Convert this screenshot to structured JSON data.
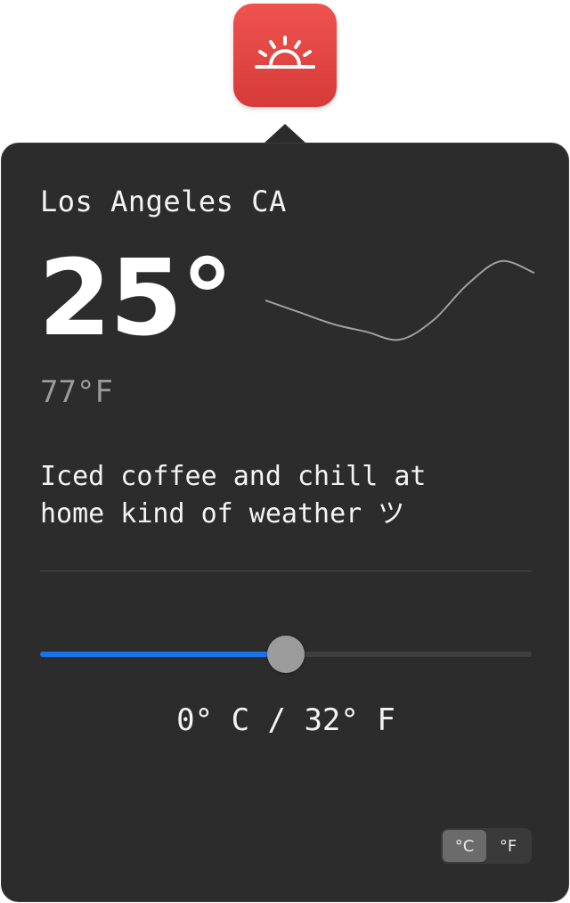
{
  "app_icon": {
    "icon": "sunrise-icon",
    "color": "#e5453f"
  },
  "weather": {
    "location": "Los Angeles CA",
    "temperature_main": "25°",
    "temperature_secondary": "77°F",
    "description_line1": "Iced coffee and chill at",
    "description_line2": "home kind of weather ツ"
  },
  "trend": {
    "values": [
      10,
      7,
      4,
      2,
      0,
      5,
      14,
      20,
      17
    ]
  },
  "converter": {
    "slider_percent": 50,
    "slider_fill_color": "#1a73e8",
    "conversion_text": "0° C / 32° F"
  },
  "unit_toggle": {
    "options": [
      {
        "label": "°C",
        "selected": true
      },
      {
        "label": "°F",
        "selected": false
      }
    ]
  }
}
